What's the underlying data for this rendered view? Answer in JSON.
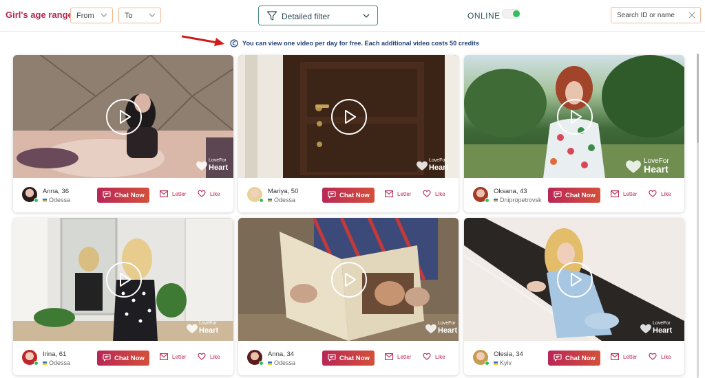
{
  "filters": {
    "age_label": "Girl's age range",
    "from_label": "From",
    "to_label": "To",
    "detailed_filter_label": "Detailed filter",
    "online_label": "ONLINE",
    "online_enabled": true,
    "search_placeholder": "Search ID or name"
  },
  "notice": {
    "text": "You can view one video per day for free. Each additional video costs 50 credits"
  },
  "buttons": {
    "chat": "Chat Now",
    "letter": "Letter",
    "like": "Like"
  },
  "watermark": {
    "line1": "LoveFor",
    "line2": "Heart"
  },
  "colors": {
    "accent": "#b5274f",
    "chat_gradient_start": "#b92757",
    "chat_gradient_end": "#d4503a",
    "online_dot": "#2fbf5c",
    "notice_text": "#1f3f74"
  },
  "cards": [
    {
      "name": "Anna, 36",
      "city": "Odessa",
      "online": true
    },
    {
      "name": "Mariya, 50",
      "city": "Odessa",
      "online": true
    },
    {
      "name": "Oksana, 43",
      "city": "Dnipropetrovsk",
      "online": true
    },
    {
      "name": "Irina, 61",
      "city": "Odessa",
      "online": true
    },
    {
      "name": "Anna, 34",
      "city": "Odessa",
      "online": true
    },
    {
      "name": "Olesia, 34",
      "city": "Kyiv",
      "online": true
    }
  ]
}
